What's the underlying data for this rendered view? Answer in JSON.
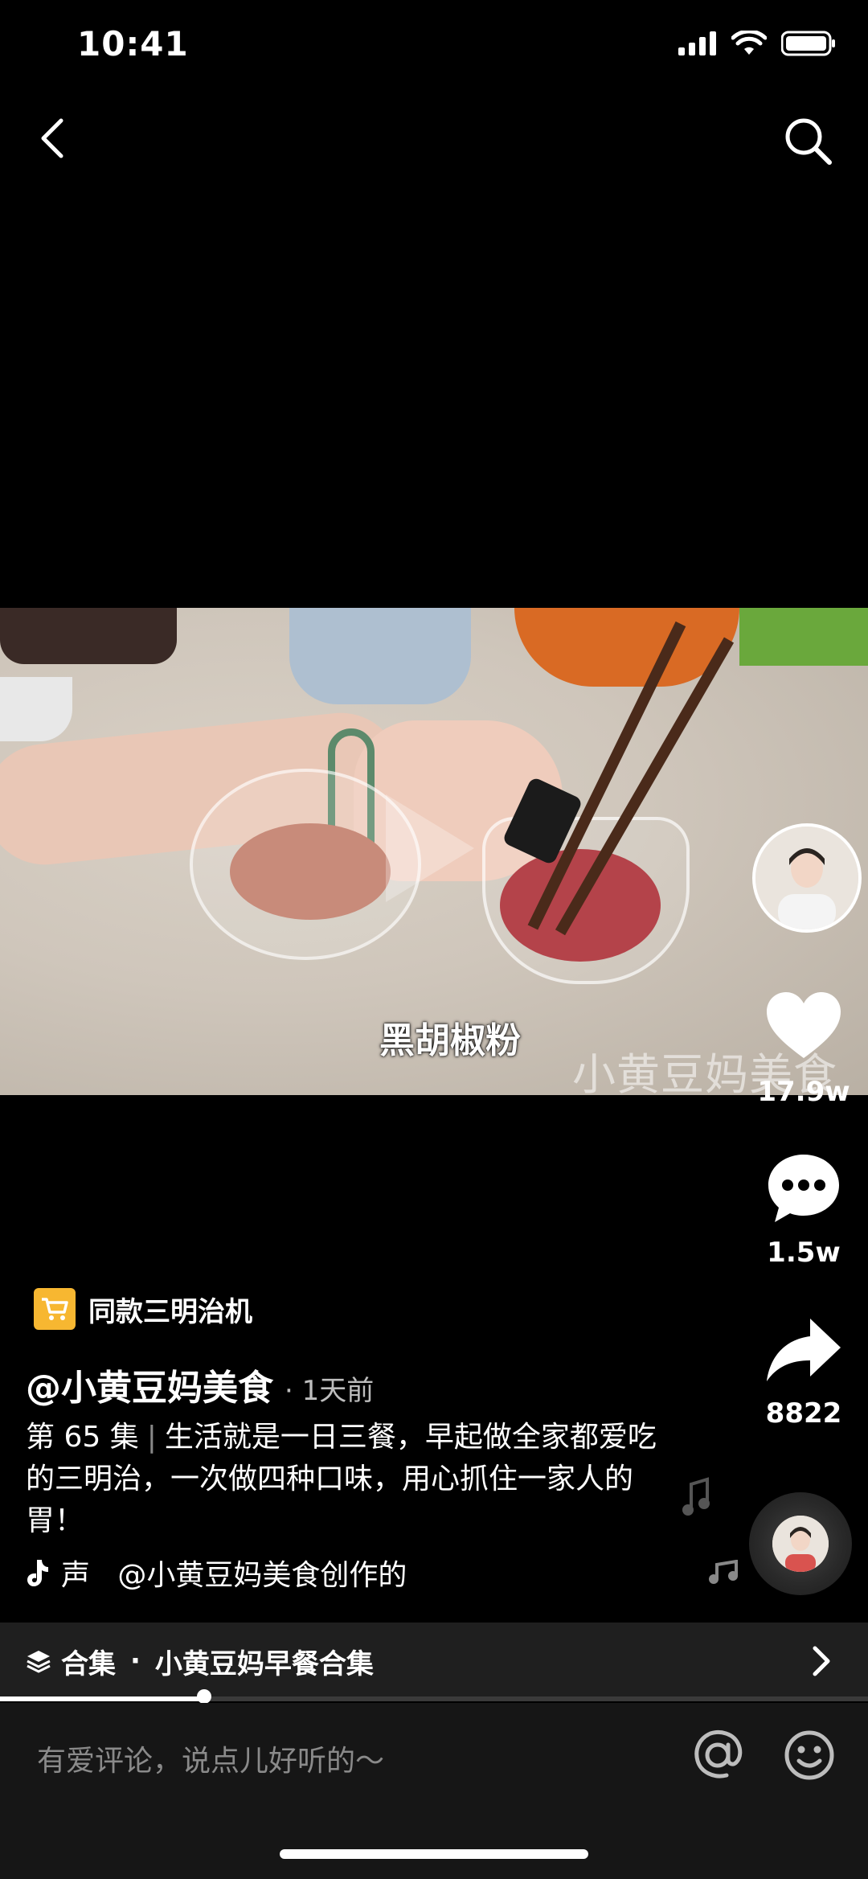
{
  "status_bar": {
    "time": "10:41"
  },
  "nav": {
    "back_icon": "chevron-left-icon",
    "search_icon": "search-icon"
  },
  "video": {
    "subtitle": "黑胡椒粉",
    "watermark": "小黄豆妈美食"
  },
  "rail": {
    "like_count": "17.9w",
    "comment_count": "1.5w",
    "share_count": "8822"
  },
  "product": {
    "label": "同款三明治机"
  },
  "author": {
    "name": "@小黄豆妈美食",
    "time_ago": "· 1天前"
  },
  "description": {
    "episode": "第 65 集",
    "text": "生活就是一日三餐，早起做全家都爱吃的三明治，一次做四种口味，用心抓住一家人的胃！"
  },
  "music": {
    "text": "声   @小黄豆妈美食创作的"
  },
  "collection": {
    "prefix": "合集",
    "dot": "·",
    "name": "小黄豆妈早餐合集"
  },
  "progress": {
    "fraction": 0.235
  },
  "comment": {
    "placeholder": "有爱评论，说点儿好听的～"
  },
  "colors": {
    "accent_cart": "#f7b731",
    "background": "#000000",
    "bar": "#1f1f1f"
  }
}
